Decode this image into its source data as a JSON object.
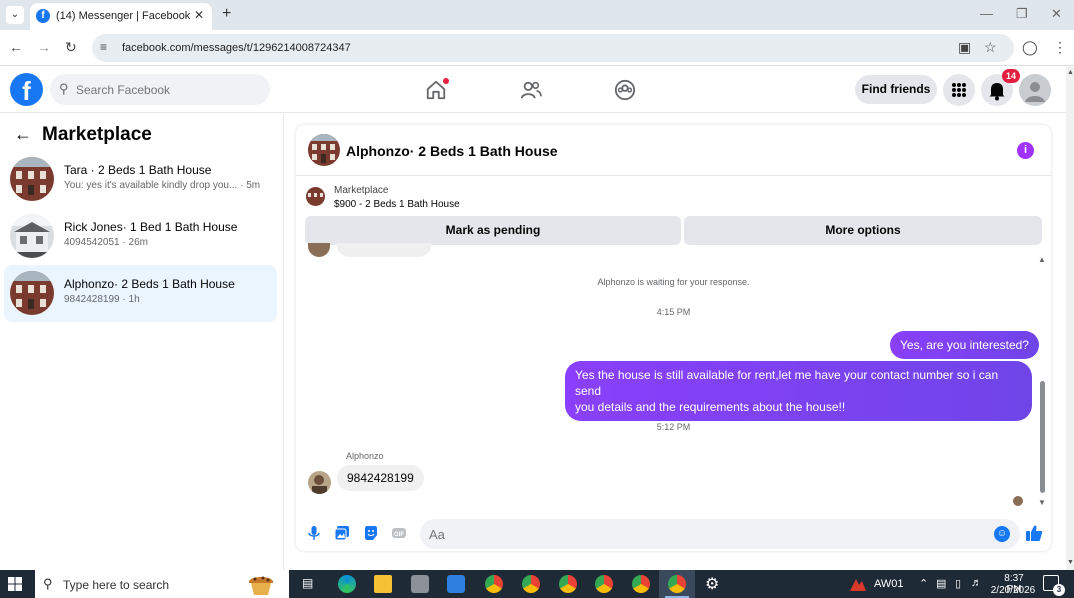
{
  "browser": {
    "tab_title": "(14) Messenger | Facebook",
    "url": "facebook.com/messages/t/1296214008724347"
  },
  "header": {
    "search_placeholder": "Search Facebook",
    "find_friends_label": "Find friends",
    "notification_count": "14"
  },
  "sidebar": {
    "title": "Marketplace",
    "conversations": [
      {
        "name": "Tara · 2 Beds 1 Bath House",
        "snippet": "You: yes it's available kindly drop you... · 5m"
      },
      {
        "name": "Rick Jones· 1 Bed 1 Bath House",
        "snippet": "4094542051 · 26m"
      },
      {
        "name": "Alphonzo· 2 Beds 1 Bath House",
        "snippet": "9842428199 · 1h"
      }
    ]
  },
  "chat": {
    "title": "Alphonzo· 2 Beds 1 Bath House",
    "marketplace_label": "Marketplace",
    "listing": "$900 - 2 Beds 1 Bath House",
    "mark_pending_label": "Mark as pending",
    "more_options_label": "More options",
    "waiting_notice": "Alphonzo is waiting for your response.",
    "time1": "4:15 PM",
    "out_msg1": "Yes, are you interested?",
    "out_msg2_line1": "Yes the house is still available for rent,let me have your contact number so i can send",
    "out_msg2_line2": "you details and the requirements about the house!!",
    "time2": "5:12 PM",
    "in_sender": "Alphonzo",
    "in_msg": "9842428199",
    "composer_placeholder": "Aa"
  },
  "taskbar": {
    "search_placeholder": "Type here to search",
    "app_label": "AW01",
    "time": "8:37 PM",
    "date": "2/20/2026",
    "notification_count": "3"
  },
  "colors": {
    "fb_blue": "#1877f2",
    "messenger_purple": "#7b3fe4",
    "active_row": "#ebf5ff",
    "badge_red": "#e41e3f"
  }
}
